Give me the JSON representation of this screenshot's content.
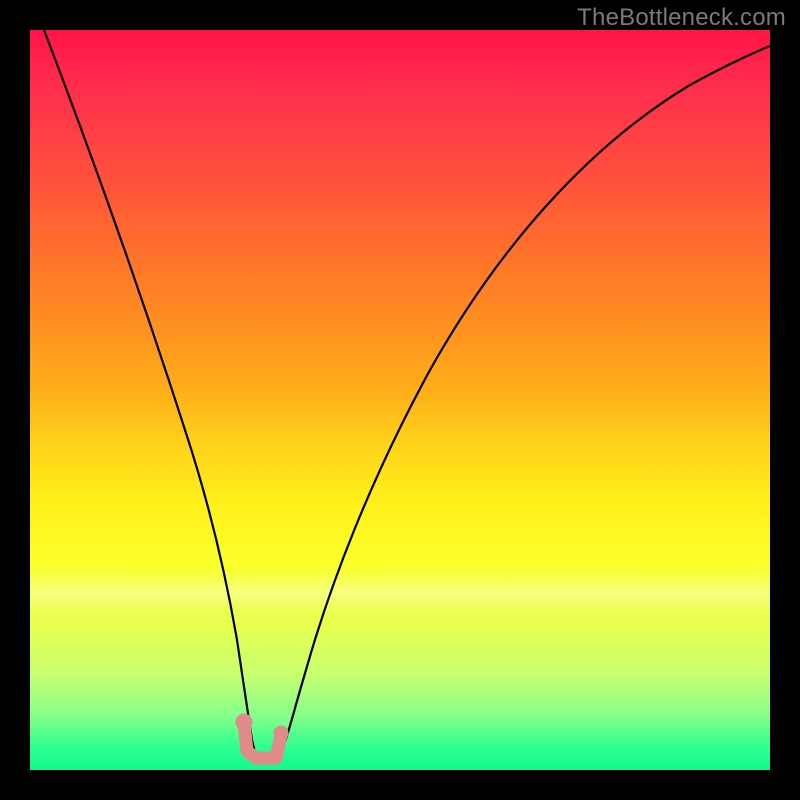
{
  "watermark": "TheBottleneck.com",
  "chart_data": {
    "type": "line",
    "title": "",
    "xlabel": "",
    "ylabel": "",
    "xlim": [
      0,
      100
    ],
    "ylim": [
      0,
      100
    ],
    "grid": false,
    "background": "vertical spectral gradient (red top → green bottom)",
    "series": [
      {
        "name": "curve",
        "stroke": "#000000",
        "x": [
          2,
          5,
          8,
          11,
          14,
          17,
          20,
          22,
          24,
          26,
          27.5,
          28.5,
          29.5,
          30.5,
          31.5,
          33,
          34,
          35,
          36,
          38,
          41,
          45,
          50,
          56,
          63,
          71,
          80,
          90,
          100
        ],
        "y": [
          100,
          90,
          80,
          70,
          60,
          50,
          40,
          32,
          25,
          18,
          12,
          7,
          3.5,
          2,
          2,
          2.2,
          3.5,
          6,
          10,
          18,
          28,
          40,
          52,
          63,
          73,
          82,
          90,
          96,
          100
        ],
        "note": "y is bottleneck percentage; plotted visually inverted so 0% sits at bottom (optimal / green) and 100% at top (worst / red)."
      },
      {
        "name": "optimal-marker",
        "stroke": "#dd8888",
        "type": "marker-path",
        "points_xy": [
          [
            28.8,
            6.5
          ],
          [
            29.2,
            2.7
          ],
          [
            30.5,
            1.8
          ],
          [
            33.0,
            1.8
          ],
          [
            33.6,
            4.8
          ]
        ],
        "note": "Pink highlight marking the flat minimum of the curve (approx x 29–34, y ≈ 2%)."
      }
    ]
  }
}
